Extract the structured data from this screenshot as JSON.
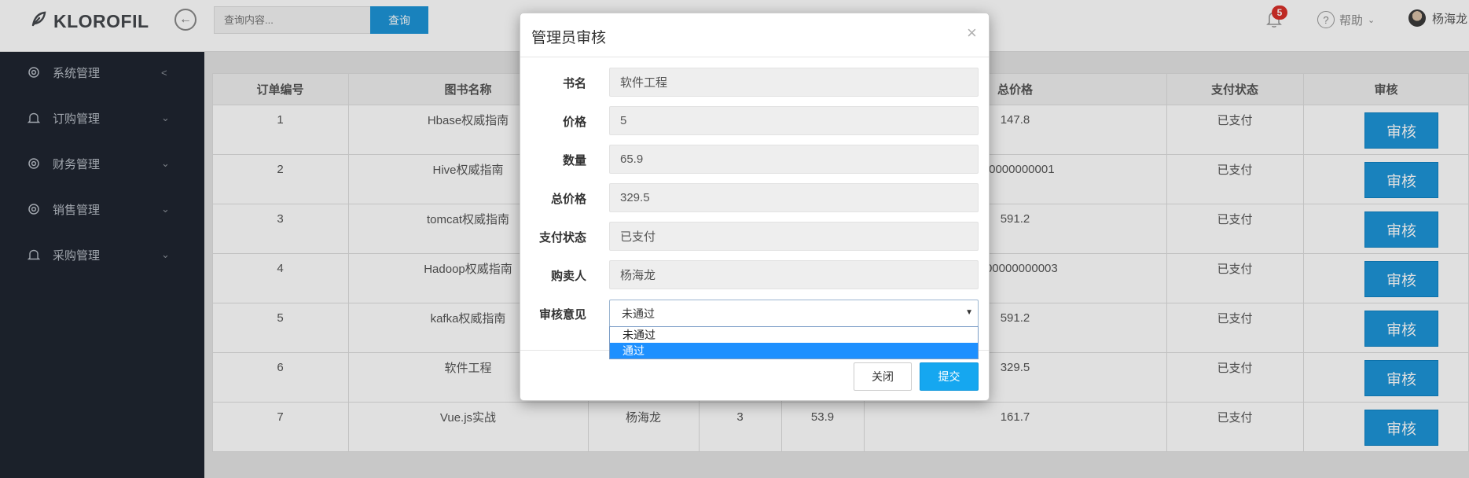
{
  "header": {
    "brand": "KLOROFIL",
    "search_placeholder": "查询内容...",
    "search_button": "查询",
    "notification_count": "5",
    "help_label": "帮助",
    "user_name": "杨海龙"
  },
  "sidebar": {
    "items": [
      {
        "label": "系统管理",
        "icon": "gear-icon",
        "chevron": "left"
      },
      {
        "label": "订购管理",
        "icon": "bell-icon",
        "chevron": "down"
      },
      {
        "label": "财务管理",
        "icon": "gear-icon",
        "chevron": "down"
      },
      {
        "label": "销售管理",
        "icon": "gear-icon",
        "chevron": "down"
      },
      {
        "label": "采购管理",
        "icon": "bell-icon",
        "chevron": "down"
      }
    ]
  },
  "table": {
    "headers": [
      "订单编号",
      "图书名称",
      "",
      "",
      "",
      "总价格",
      "支付状态",
      "审核"
    ],
    "rows": [
      {
        "id": "1",
        "book": "Hbase权威指南",
        "buyer": "",
        "qty": "",
        "price": "",
        "total": "147.8",
        "status": "已支付",
        "action": "审核"
      },
      {
        "id": "2",
        "book": "Hive权威指南",
        "buyer": "",
        "qty": "",
        "price": "",
        "total": "000000000001",
        "status": "已支付",
        "action": "审核"
      },
      {
        "id": "3",
        "book": "tomcat权威指南",
        "buyer": "",
        "qty": "",
        "price": "",
        "total": "591.2",
        "status": "已支付",
        "action": "审核"
      },
      {
        "id": "4",
        "book": "Hadoop权威指南",
        "buyer": "",
        "qty": "",
        "price": "",
        "total": "0000000000003",
        "status": "已支付",
        "action": "审核"
      },
      {
        "id": "5",
        "book": "kafka权威指南",
        "buyer": "",
        "qty": "",
        "price": "",
        "total": "591.2",
        "status": "已支付",
        "action": "审核"
      },
      {
        "id": "6",
        "book": "软件工程",
        "buyer": "",
        "qty": "",
        "price": "",
        "total": "329.5",
        "status": "已支付",
        "action": "审核"
      },
      {
        "id": "7",
        "book": "Vue.js实战",
        "buyer": "杨海龙",
        "qty": "3",
        "price": "53.9",
        "total": "161.7",
        "status": "已支付",
        "action": "审核"
      }
    ]
  },
  "modal": {
    "title": "管理员审核",
    "close_glyph": "×",
    "fields": [
      {
        "label": "书名",
        "value": "软件工程"
      },
      {
        "label": "价格",
        "value": "5"
      },
      {
        "label": "数量",
        "value": "65.9"
      },
      {
        "label": "总价格",
        "value": "329.5"
      },
      {
        "label": "支付状态",
        "value": "已支付"
      },
      {
        "label": "购卖人",
        "value": "杨海龙"
      }
    ],
    "review_label": "审核意见",
    "review_selected": "未通过",
    "review_options": [
      "未通过",
      "通过"
    ],
    "highlighted_option": "通过",
    "close_button": "关闭",
    "submit_button": "提交"
  },
  "colors": {
    "accent": "#1d95d8",
    "sidebar_bg": "#1f2530",
    "badge": "#d9302a",
    "submit": "#15a7f0",
    "dropdown_highlight": "#1e90ff"
  }
}
